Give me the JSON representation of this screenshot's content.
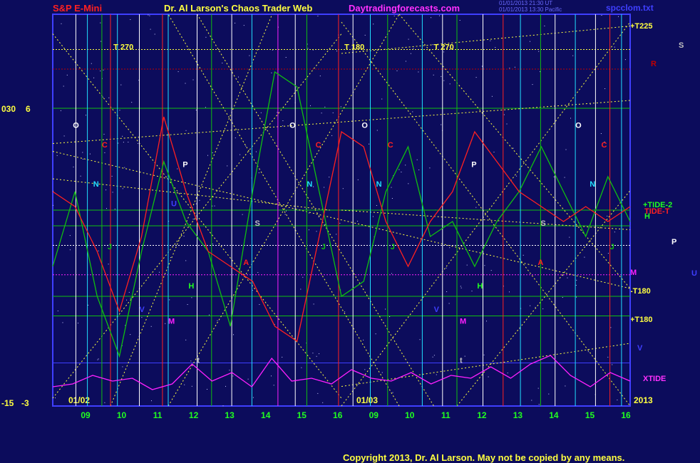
{
  "header": {
    "symbol": "S&P E-Mini",
    "title": "Dr. Al Larson's Chaos Trader Web",
    "site": "Daytradingforecasts.com",
    "timestamp1": "01/01/2013 21:30 UT",
    "timestamp2": "01/01/2013 13:30 Pacific",
    "file": "spcclom.txt"
  },
  "footer": {
    "copyright": "Copyright 2013, Dr. Al Larson. May not be copied by any means."
  },
  "left_scale": {
    "top_a": "030",
    "top_b": "6",
    "bottom_a": "-15",
    "bottom_b": "-3"
  },
  "dates": {
    "day1": "01/02",
    "day2": "01/03",
    "year": "2013"
  },
  "right_labels": [
    "+T225",
    "+TIDE-2",
    "TIDE-T",
    "H",
    "M",
    "-T180",
    "+T180",
    "V",
    "XTIDE",
    "S",
    "R",
    "P",
    "U"
  ],
  "colors": {
    "background": "#0c0c5c",
    "plot_border": "#3f3fff",
    "green_line": "#10c010",
    "red_line": "#ff2020",
    "magenta_line": "#ff20ff",
    "cyan_line": "#20e0ff",
    "white_line": "#ffffff",
    "yellow": "#ffff40"
  },
  "chart_data": {
    "type": "line",
    "x_ticks": [
      "09",
      "10",
      "11",
      "12",
      "13",
      "14",
      "15",
      "16",
      "09",
      "10",
      "11",
      "12",
      "13",
      "14",
      "15",
      "16"
    ],
    "xlabel": "",
    "ylabel": "",
    "planet_glyphs": [
      "T  270",
      "T  180",
      "T  270",
      "O",
      "O",
      "O",
      "O",
      "C",
      "C",
      "C",
      "C",
      "N",
      "N",
      "N",
      "N",
      "P",
      "P",
      "S",
      "S",
      "H",
      "H",
      "M",
      "M",
      "A",
      "A",
      "V",
      "V",
      "t",
      "t",
      "J",
      "J",
      "J",
      "J",
      "U"
    ],
    "series": [
      {
        "name": "green",
        "values": [
          0.3,
          0.55,
          0.2,
          0.0,
          0.35,
          0.65,
          0.45,
          0.35,
          0.1,
          0.55,
          0.95,
          0.9,
          0.55,
          0.2,
          0.25,
          0.55,
          0.7,
          0.4,
          0.45,
          0.3,
          0.45,
          0.55,
          0.7,
          0.55,
          0.4,
          0.6,
          0.45
        ]
      },
      {
        "name": "red",
        "values": [
          0.55,
          0.5,
          0.35,
          0.15,
          0.4,
          0.8,
          0.55,
          0.35,
          0.3,
          0.25,
          0.1,
          0.05,
          0.4,
          0.75,
          0.7,
          0.45,
          0.3,
          0.45,
          0.55,
          0.75,
          0.65,
          0.55,
          0.5,
          0.45,
          0.5,
          0.45,
          0.5
        ]
      },
      {
        "name": "XTIDE",
        "values": [
          0.15,
          0.2,
          0.35,
          0.25,
          0.3,
          0.1,
          0.2,
          0.55,
          0.25,
          0.4,
          0.15,
          0.65,
          0.25,
          0.3,
          0.2,
          0.45,
          0.3,
          0.25,
          0.4,
          0.2,
          0.35,
          0.3,
          0.5,
          0.3,
          0.55,
          0.7,
          0.35,
          0.15,
          0.4,
          0.25
        ]
      }
    ]
  }
}
